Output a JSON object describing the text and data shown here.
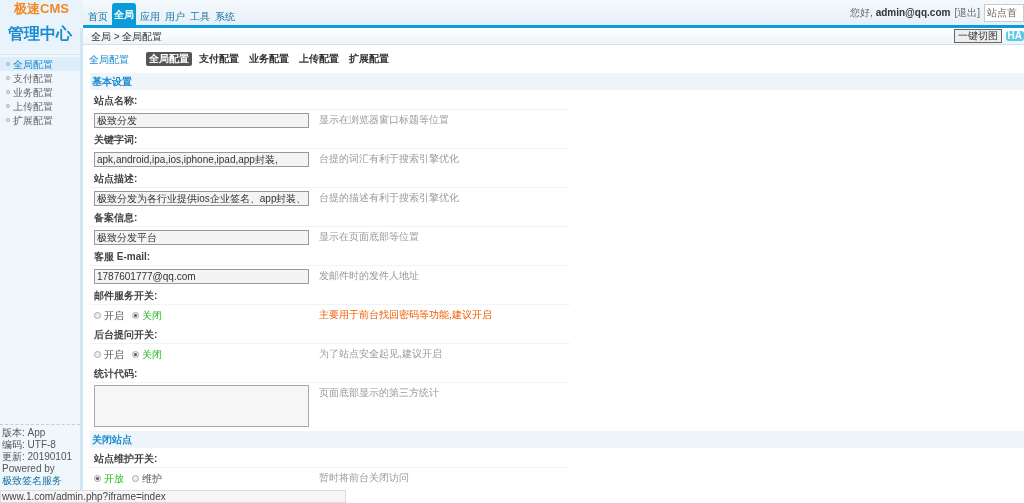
{
  "logo": {
    "line_1": "极速CMS",
    "line_2": "管理中心"
  },
  "nav": [
    {
      "label": "首页",
      "selected": false
    },
    {
      "label": "全局",
      "selected": true
    },
    {
      "label": "应用",
      "selected": false
    },
    {
      "label": "用户",
      "selected": false
    },
    {
      "label": "工具",
      "selected": false
    },
    {
      "label": "系统",
      "selected": false
    }
  ],
  "user": {
    "greeting": "您好,",
    "name": "admin@qq.com",
    "logout": "[退出]",
    "site_field": "站点首"
  },
  "breadcrumb": "全局 > 全局配置",
  "toolbar": {
    "button": "一键切图",
    "badge": "HA"
  },
  "sidebar": {
    "items": [
      {
        "label": "全局配置",
        "selected": true
      },
      {
        "label": "支付配置",
        "selected": false
      },
      {
        "label": "业务配置",
        "selected": false
      },
      {
        "label": "上传配置",
        "selected": false
      },
      {
        "label": "扩展配置",
        "selected": false
      }
    ],
    "info": [
      "版本: App",
      "编码: UTF-8",
      "更新: 20190101"
    ],
    "powered": "Powered by",
    "powered_link": "极致签名服务"
  },
  "page_title": "全局配置",
  "tabs": [
    {
      "label": "全局配置",
      "selected": true
    },
    {
      "label": "支付配置",
      "selected": false
    },
    {
      "label": "业务配置",
      "selected": false
    },
    {
      "label": "上传配置",
      "selected": false
    },
    {
      "label": "扩展配置",
      "selected": false
    }
  ],
  "sections": [
    {
      "title": "基本设置",
      "fields": [
        {
          "kind": "text",
          "label": "站点名称:",
          "value": "极致分发",
          "hint": "显示在浏览器窗口标题等位置",
          "highlight": false
        },
        {
          "kind": "text",
          "label": "关键字词:",
          "value": "apk,android,ipa,ios,iphone,ipad,app封装,",
          "hint": "台提的词汇有利于搜索引擎优化",
          "highlight": false
        },
        {
          "kind": "text",
          "label": "站点描述:",
          "value": "极致分发为各行业提供ios企业签名、app封装、",
          "hint": "台提的描述有利于搜索引擎优化",
          "highlight": false
        },
        {
          "kind": "text",
          "label": "备案信息:",
          "value": "极致分发平台",
          "hint": "显示在页面底部等位置",
          "highlight": false
        },
        {
          "kind": "text",
          "label": "客服 E-mail:",
          "value": "1787601777@qq.com",
          "hint": "发邮件时的发件人地址",
          "highlight": false
        },
        {
          "kind": "radio",
          "label": "邮件服务开关:",
          "options": [
            {
              "label": "开启",
              "selected": false
            },
            {
              "label": "关闭",
              "selected": true
            }
          ],
          "hint": "主要用于前台找回密码等功能,建议开启",
          "highlight": true
        },
        {
          "kind": "radio",
          "label": "后台提问开关:",
          "options": [
            {
              "label": "开启",
              "selected": false
            },
            {
              "label": "关闭",
              "selected": true
            }
          ],
          "hint": "为了站点安全起见,建议开启",
          "highlight": false
        },
        {
          "kind": "textarea",
          "label": "统计代码:",
          "hint": "页面底部显示的第三方统计",
          "highlight": false
        }
      ]
    },
    {
      "title": "关闭站点",
      "fields": [
        {
          "kind": "radio",
          "label": "站点维护开关:",
          "options": [
            {
              "label": "开放",
              "selected": true
            },
            {
              "label": "维护",
              "selected": false
            }
          ],
          "hint": "暂时将前台关闭访问",
          "highlight": false
        }
      ]
    }
  ],
  "status_url": "www.1.com/admin.php?iframe=index"
}
